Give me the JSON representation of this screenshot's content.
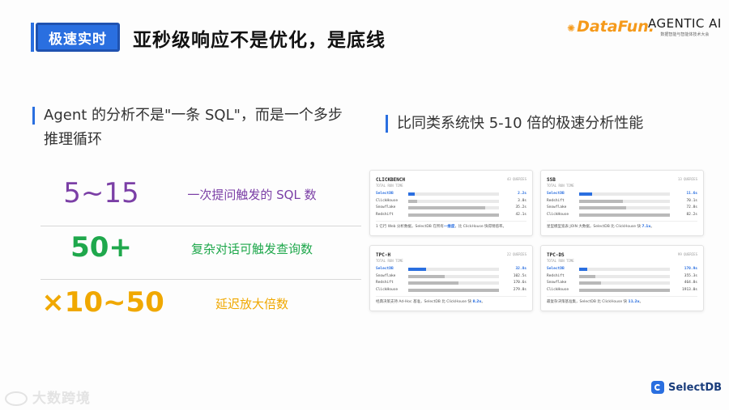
{
  "header": {
    "tag": "极速实时",
    "title": "亚秒级响应不是优化，是底线",
    "logo_datafun": "DataFun.",
    "logo_agentic": "AGENTIC AI",
    "logo_agentic_sub": "数据智能与智能体技术大会"
  },
  "left": {
    "heading_line1": "Agent 的分析不是\"一条 SQL\"，而是一个多步",
    "heading_line2": "推理循环",
    "stats": [
      {
        "value": "5~15",
        "label": "一次提问触发的 SQL 数",
        "color": "#7b3fa6"
      },
      {
        "value": "50+",
        "label": "复杂对话可触发查询数",
        "color": "#1fa84c"
      },
      {
        "value": "×10~50",
        "label": "延迟放大倍数",
        "color": "#f0a800"
      }
    ]
  },
  "right": {
    "heading": "比同类系统快 5-10 倍的极速分析性能",
    "panels": [
      {
        "name": "CLICKBENCH",
        "meta": "43 QUERIES",
        "sub": "TOTAL RUN TIME",
        "rows": [
          {
            "label": "SelectDB",
            "value": "2.2s",
            "fill": 0.07,
            "hl": true
          },
          {
            "label": "ClickHouse",
            "value": "3.8s",
            "fill": 0.1,
            "hl": false
          },
          {
            "label": "Snowflake",
            "value": "35.2s",
            "fill": 0.85,
            "hl": false
          },
          {
            "label": "Redshift",
            "value": "42.1s",
            "fill": 1.0,
            "hl": false
          }
        ],
        "foot_pre": "1 亿行 Web 分析数据，SelectDB 在所有",
        "foot_hl": "一维度",
        "foot_post": "，比 ClickHouse 快得稍倍率。"
      },
      {
        "name": "SSB",
        "meta": "13 QUERIES",
        "sub": "TOTAL RUN TIME",
        "rows": [
          {
            "label": "SelectDB",
            "value": "11.6s",
            "fill": 0.14,
            "hl": true
          },
          {
            "label": "Redshift",
            "value": "70.1s",
            "fill": 0.48,
            "hl": false
          },
          {
            "label": "Snowflake",
            "value": "72.8s",
            "fill": 0.52,
            "hl": false
          },
          {
            "label": "ClickHouse",
            "value": "82.2s",
            "fill": 1.0,
            "hl": false
          }
        ],
        "foot_pre": "星型模型宽表 JOIN 大数据，SelectDB 比 ClickHouse 快 ",
        "foot_hl": "7.1x",
        "foot_post": "。"
      },
      {
        "name": "TPC-H",
        "meta": "22 QUERIES",
        "sub": "TOTAL RUN TIME",
        "rows": [
          {
            "label": "SelectDB",
            "value": "32.8s",
            "fill": 0.2,
            "hl": true
          },
          {
            "label": "Snowflake",
            "value": "102.5s",
            "fill": 0.4,
            "hl": false
          },
          {
            "label": "Redshift",
            "value": "170.6s",
            "fill": 0.55,
            "hl": false
          },
          {
            "label": "ClickHouse",
            "value": "279.8s",
            "fill": 1.0,
            "hl": false
          }
        ],
        "foot_pre": "经典决策支持 Ad-Hoc 基准，SelectDB 比 ClickHouse 快 ",
        "foot_hl": "8.2x",
        "foot_post": "。"
      },
      {
        "name": "TPC-DS",
        "meta": "99 QUERIES",
        "sub": "TOTAL RUN TIME",
        "rows": [
          {
            "label": "SelectDB",
            "value": "170.9s",
            "fill": 0.09,
            "hl": true
          },
          {
            "label": "Redshift",
            "value": "355.3s",
            "fill": 0.18,
            "hl": false
          },
          {
            "label": "Snowflake",
            "value": "464.8s",
            "fill": 0.24,
            "hl": false
          },
          {
            "label": "ClickHouse",
            "value": "1913.0s",
            "fill": 1.0,
            "hl": false
          }
        ],
        "foot_pre": "最复杂决策基准集，SelectDB 比 ClickHouse 快 ",
        "foot_hl": "11.2x",
        "foot_post": "。"
      }
    ]
  },
  "footer": {
    "watermark": "大数跨境",
    "brand": "SelectDB"
  }
}
